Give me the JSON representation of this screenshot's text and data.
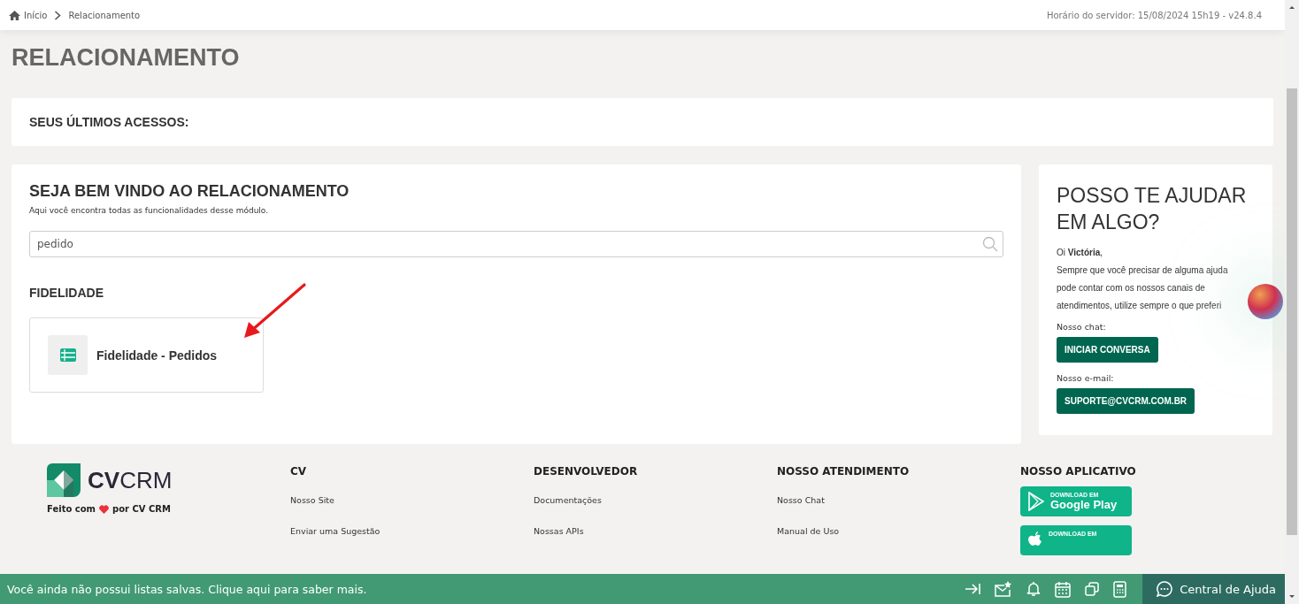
{
  "breadcrumb": [
    "Início",
    "Relacionamento"
  ],
  "server_info": "Horário do servidor: 15/08/2024 15h19 - v24.8.4",
  "page_title": "RELACIONAMENTO",
  "recent_access": {
    "title": "SEUS ÚLTIMOS ACESSOS:"
  },
  "welcome": {
    "title": "SEJA BEM VINDO AO RELACIONAMENTO",
    "subtitle": "Aqui você encontra todas as funcionalidades desse módulo.",
    "search": {
      "value": "pedido"
    },
    "sections": [
      {
        "title": "FIDELIDADE",
        "items": [
          {
            "label": "Fidelidade - Pedidos"
          }
        ]
      }
    ]
  },
  "help": {
    "title": "POSSO TE AJUDAR EM ALGO?",
    "greeting": "Oi **Victória**,",
    "message": "Sempre que você precisar de alguma ajuda pode contar com os nossos canais de atendimentos, utilize sempre o que preferi",
    "chat_label": "Nosso chat:",
    "chat_button": "INICIAR CONVERSA",
    "email_label": "Nosso e-mail:",
    "email_button": "SUPORTE@CVCRM.COM.BR"
  },
  "footer": {
    "logo": {
      "bold": "CV",
      "light": "CRM"
    },
    "made_with": [
      "Feito com",
      "por CV CRM"
    ],
    "columns": [
      {
        "title": "CV",
        "links": [
          "Nosso Site",
          "Enviar uma Sugestão"
        ]
      },
      {
        "title": "DESENVOLVEDOR",
        "links": [
          "Documentações",
          "Nossas APIs"
        ]
      },
      {
        "title": "NOSSO ATENDIMENTO",
        "links": [
          "Nosso Chat",
          "Manual de Uso"
        ]
      }
    ],
    "app": {
      "title": "NOSSO APLICATIVO",
      "badges": [
        {
          "kind": "google",
          "small": "DOWNLOAD EM",
          "big": "Google Play"
        },
        {
          "kind": "apple",
          "small": "DOWNLOAD EM"
        }
      ]
    }
  },
  "bottom_bar": {
    "message": "Você ainda não possui listas salvas. Clique aqui para saber mais.",
    "help_button": "Central de Ajuda"
  }
}
